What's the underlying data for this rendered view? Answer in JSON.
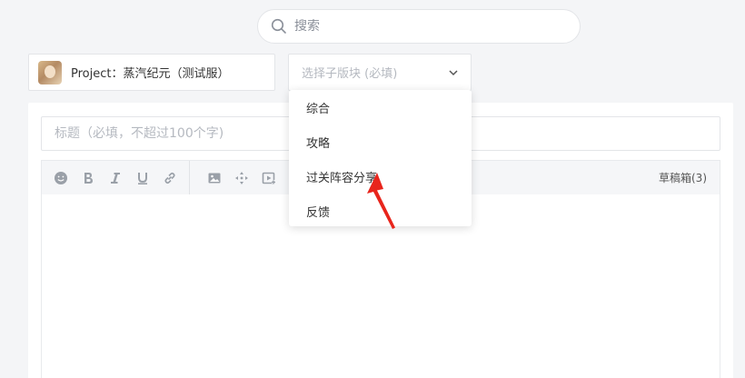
{
  "search": {
    "placeholder": "搜索"
  },
  "project": {
    "label": "Project：蒸汽纪元（测试服）"
  },
  "subforum_select": {
    "placeholder": "选择子版块 (必填)"
  },
  "dropdown": {
    "items": [
      "综合",
      "攻略",
      "过关阵容分享",
      "反馈"
    ]
  },
  "title_field": {
    "placeholder": "标题（必填，不超过100个字)"
  },
  "toolbar": {
    "drafts_label": "草稿箱(3)"
  },
  "icons": {
    "search": "search-icon",
    "chevron": "chevron-down-icon",
    "emoji": "emoji-icon",
    "bold": "bold-icon",
    "italic": "italic-icon",
    "underline": "underline-icon",
    "link": "link-icon",
    "image": "image-icon",
    "move": "move-icon",
    "video": "video-icon"
  },
  "colors": {
    "annotation_arrow": "#e8251c",
    "icon_gray": "#9aa0a8"
  }
}
